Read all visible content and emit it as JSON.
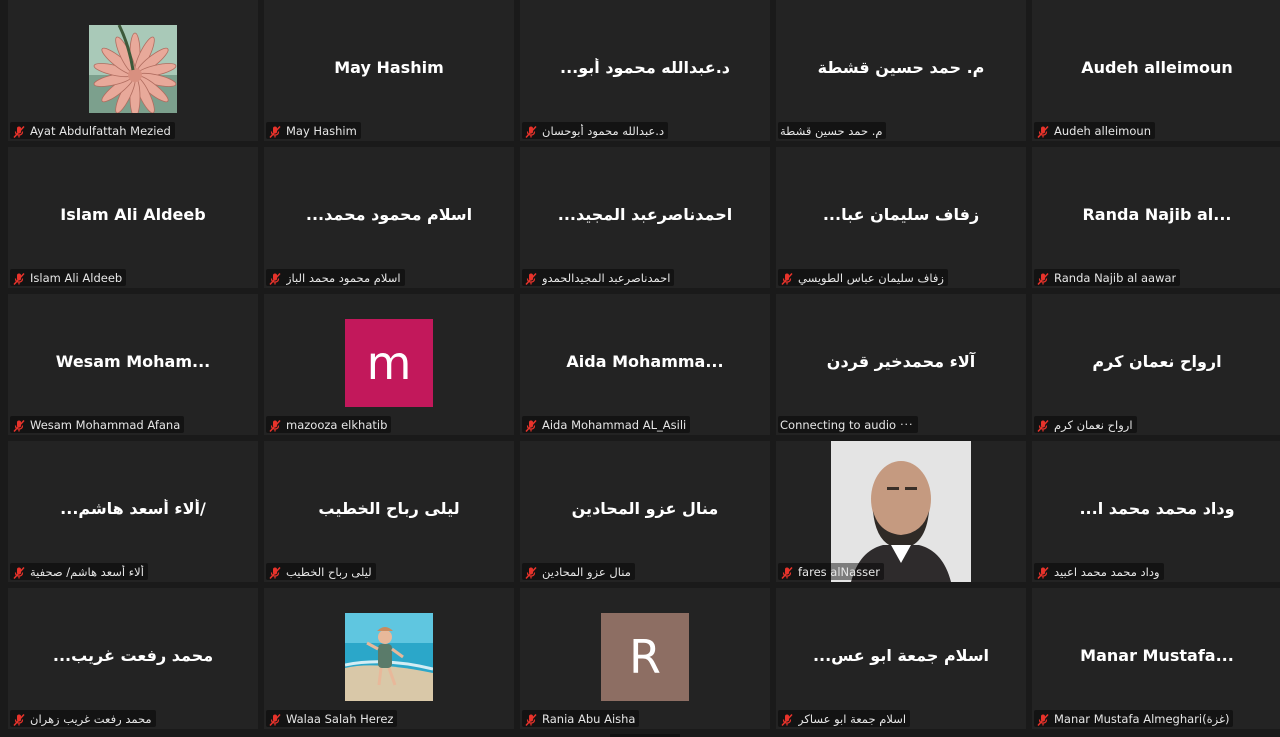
{
  "colors": {
    "tile_bg": "#232323",
    "page_bg": "#1a1a1a",
    "muted_mic": "#e8332b",
    "avatar_m": "#c2185b",
    "avatar_r": "#8d6e63"
  },
  "participants": [
    {
      "center": "",
      "footer": "Ayat Abdulfattah Mezied",
      "muted": true,
      "avatar": "flower-photo"
    },
    {
      "center": "May Hashim",
      "footer": "May Hashim",
      "muted": true
    },
    {
      "center": "...د.عبدالله محمود أبو",
      "footer": "د.عبدالله محمود أبوحسان",
      "muted": true
    },
    {
      "center": "م. حمد حسين قشطة",
      "footer": "م. حمد حسين قشطة",
      "muted": false
    },
    {
      "center": "Audeh alleimoun",
      "footer": "Audeh alleimoun",
      "muted": true
    },
    {
      "center": "Islam Ali Aldeeb",
      "footer": "Islam Ali Aldeeb",
      "muted": true
    },
    {
      "center": "...اسلام محمود محمد",
      "footer": "اسلام محمود محمد الباز",
      "muted": true
    },
    {
      "center": "...احمدناصرعبد المجيد",
      "footer": "احمدناصرعبد المجيدالحمدو",
      "muted": true
    },
    {
      "center": "...زفاف سليمان عبا",
      "footer": "زفاف سليمان عباس الطويسي",
      "muted": true
    },
    {
      "center": "Randa  Najib al...",
      "footer": "Randa  Najib al aawar",
      "muted": true
    },
    {
      "center": "Wesam  Moham...",
      "footer": "Wesam Mohammad Afana",
      "muted": true
    },
    {
      "center": "",
      "footer": "mazooza elkhatib",
      "muted": true,
      "avatar_letter": "m"
    },
    {
      "center": "Aida  Mohamma...",
      "footer": "Aida Mohammad AL_Asili",
      "muted": true
    },
    {
      "center": "آلاء محمدخير قردن",
      "footer": "Connecting to audio",
      "muted": false,
      "connecting": true
    },
    {
      "center": "ارواح نعمان كرم",
      "footer": "ارواح نعمان كرم",
      "muted": true
    },
    {
      "center": "...ألاء أسعد هاشم/",
      "footer": "ألاء أسعد هاشم/ صحفية",
      "muted": true
    },
    {
      "center": "ليلى رباح الخطيب",
      "footer": "ليلى رباح الخطيب",
      "muted": true
    },
    {
      "center": "منال عزو المحادين",
      "footer": "منال عزو المحادين",
      "muted": true
    },
    {
      "center": "",
      "footer": "fares alNasser",
      "muted": true,
      "avatar": "man-photo"
    },
    {
      "center": "...وداد محمد محمد ا",
      "footer": "وداد محمد محمد اعبيد",
      "muted": true
    },
    {
      "center": "...محمد رفعت غريب",
      "footer": "محمد رفعت غريب زهران",
      "muted": true
    },
    {
      "center": "",
      "footer": "Walaa Salah Herez",
      "muted": true,
      "avatar": "beach-photo"
    },
    {
      "center": "",
      "footer": "Rania Abu Aisha",
      "muted": true,
      "avatar_letter": "R"
    },
    {
      "center": "...اسلام جمعة ابو عس",
      "footer": "اسلام جمعة ابو عساكر",
      "muted": true
    },
    {
      "center": "Manar  Mustafa...",
      "footer": "Manar Mustafa Almeghari(غزة)",
      "muted": true
    }
  ],
  "connecting_dots": "···"
}
